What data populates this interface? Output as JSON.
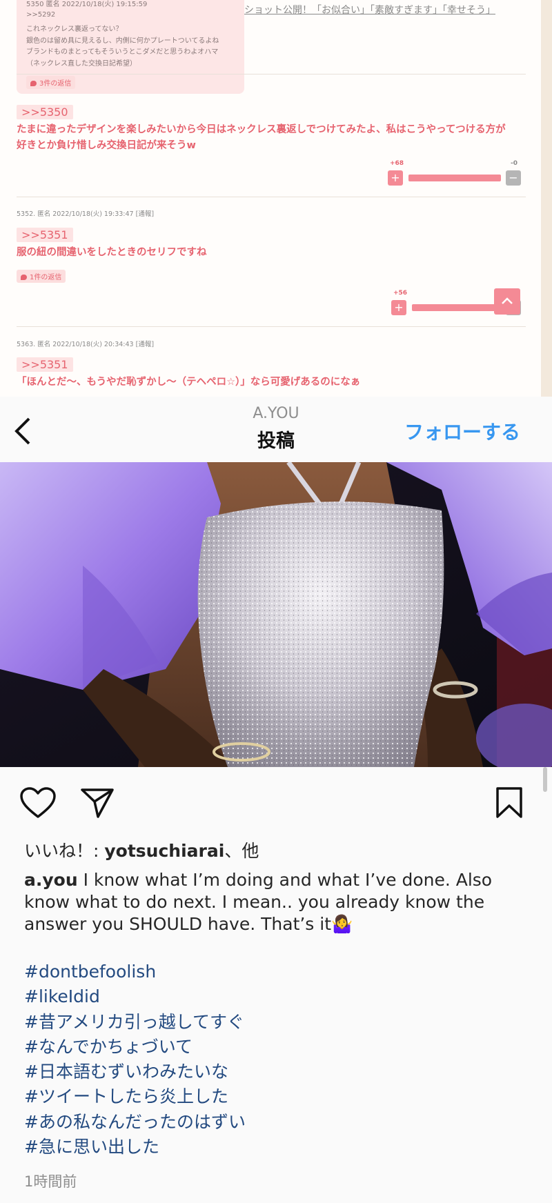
{
  "forum": {
    "header_link": "ショット公開！「お似合い」「素敵すぎます」「幸せそう」",
    "tooltip": {
      "meta": "5350 匿名 2022/10/18(火) 19:15:59",
      "lines": [
        ">>5292",
        "これネックレス裏返ってない？",
        "銀色のは留め具に見えるし、内側に何かプレートついてるよね",
        "ブランドものまとってもそういうとこダメだと思うわよオハマ",
        "（ネックレス直した交換日記希望）"
      ],
      "replies": "3件の返信"
    },
    "posts": [
      {
        "anchor": ">>5350",
        "body_line1": "たまに違ったデザインを楽しみたいから今日はネックレス裏返しでつけてみたよ、私はこうやってつける方が",
        "body_line2": "好きとか負け惜しみ交換日記が来そうw",
        "plus": "+68",
        "minus": "-0"
      },
      {
        "meta": "5352. 匿名 2022/10/18(火) 19:33:47",
        "report": "[通報]",
        "anchor": ">>5351",
        "body": "服の紐の間違いをしたときのセリフですね",
        "replies": "1件の返信",
        "plus": "+56"
      },
      {
        "meta": "5363. 匿名 2022/10/18(火) 20:34:43",
        "report": "[通報]",
        "anchor": ">>5351",
        "body": "「ほんとだ〜、もうやだ恥ずかし〜（テヘペロ☆）」なら可愛げあるのになぁ"
      }
    ],
    "vote_plus_glyph": "+",
    "vote_minus_glyph": "−"
  },
  "instagram": {
    "username": "A.YOU",
    "title": "投稿",
    "follow": "フォローする",
    "likes_prefix": "いいね！: ",
    "likes_user": "yotsuchiarai",
    "likes_suffix": "、他",
    "caption_user": "a.you",
    "caption_text": " I know what I’m doing and what I’ve done. Also know what to do next. I mean.. you already know the answer you SHOULD have. That’s it🤷‍♀️",
    "hashtags": [
      "#dontbefoolish",
      "#likeIdid",
      "#昔アメリカ引っ越してすぐ",
      "#なんでかちょづいて",
      "#日本語むずいわみたいな",
      "#ツイートしたら炎上した",
      "#あの私なんだったのはずい",
      "#急に思い出した"
    ],
    "timestamp": "1時間前",
    "icons": [
      "back-chevron-icon",
      "heart-icon",
      "share-icon",
      "bookmark-icon",
      "scroll-top-icon"
    ]
  }
}
